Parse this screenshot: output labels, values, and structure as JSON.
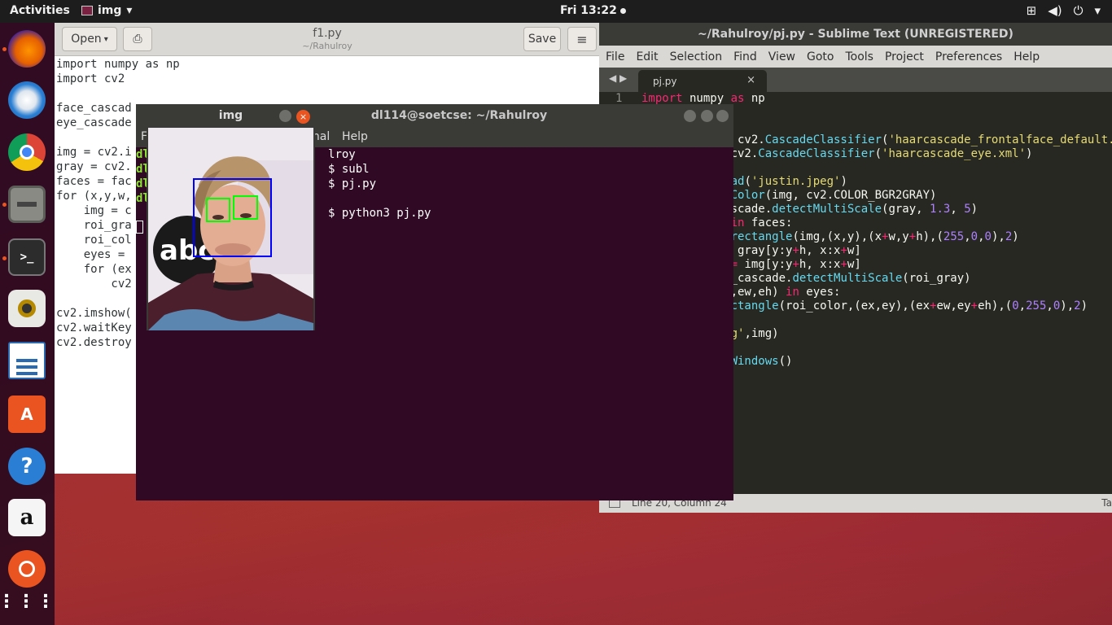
{
  "topbar": {
    "activities": "Activities",
    "app_name": "img",
    "app_menu_glyph": "▾",
    "clock": "Fri 13:22",
    "tray_icons": [
      "network-icon",
      "volume-icon",
      "power-icon",
      "chevron-down-icon"
    ]
  },
  "dock": {
    "items": [
      "firefox",
      "thunderbird",
      "chrome",
      "files",
      "terminal",
      "rhythmbox",
      "libreoffice-writer",
      "software-center",
      "help",
      "amazon",
      "ubuntu",
      "app-grid"
    ]
  },
  "gedit": {
    "open_label": "Open",
    "open_glyph": "▾",
    "title": "f1.py",
    "subtitle": "~/Rahulroy",
    "save_label": "Save",
    "menu_glyph": "≡",
    "code_lines": [
      "import numpy as np",
      "import cv2",
      "",
      "face_cascad",
      "eye_cascade",
      "",
      "img = cv2.i",
      "gray = cv2.",
      "faces = fac",
      "for (x,y,w,",
      "    img = c",
      "    roi_gra",
      "    roi_col",
      "    eyes =",
      "    for (ex",
      "        cv2",
      "",
      "cv2.imshow(",
      "cv2.waitKey",
      "cv2.destroy"
    ]
  },
  "sublime": {
    "title": "~/Rahulroy/pj.py - Sublime Text (UNREGISTERED)",
    "menu": [
      "File",
      "Edit",
      "Selection",
      "Find",
      "View",
      "Goto",
      "Tools",
      "Project",
      "Preferences",
      "Help"
    ],
    "tab_label": "pj.py",
    "tab_close": "×",
    "nav_arrows": "◀ ▶",
    "line_number": "1",
    "status": "Line 20, Column 24",
    "status_right": "Ta"
  },
  "terminal": {
    "title": "dl114@soetcse: ~/Rahulroy",
    "menu_help": "Help",
    "menu_terminal": "inal",
    "menu_file": "F",
    "lines": [
      {
        "user": "dl",
        "text": "lroy"
      },
      {
        "user": "dl",
        "text": "$ subl"
      },
      {
        "user": "dl",
        "text": "$ pj.py"
      },
      {
        "user": "dl",
        "text": ""
      },
      {
        "user": "",
        "text": "$ python3 pj.py"
      }
    ]
  },
  "imgwin": {
    "title": "img",
    "close_glyph": "×",
    "photo_overlay_text": "abc"
  },
  "colors": {
    "accent": "#e95420",
    "face_box": "#0000ff",
    "eye_box": "#00ff00"
  }
}
